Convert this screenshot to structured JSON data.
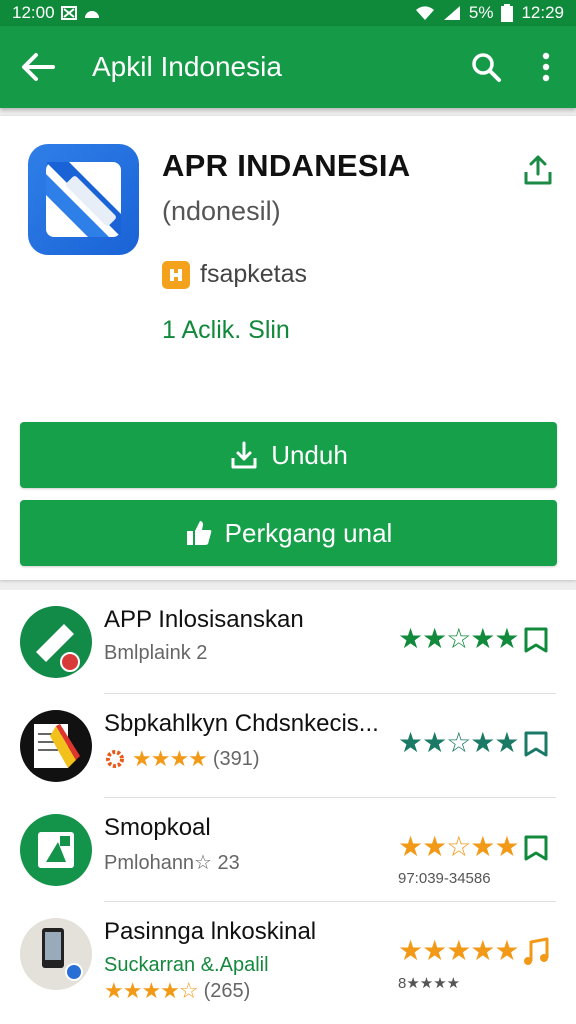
{
  "status_bar": {
    "time_left": "12:00",
    "battery": "5%",
    "time_right": "12:29"
  },
  "app_bar": {
    "title": "Apkil Indonesia"
  },
  "app": {
    "name": "APR INDANESIA",
    "subtitle": "(ndonesil)",
    "developer": "fsapketas",
    "install_info": "1 Aclik. Slin"
  },
  "buttons": {
    "primary_label": "Unduh",
    "secondary_label": "Perkgang unal"
  },
  "list": [
    {
      "title": "APP Inlosisanskan",
      "meta": "Bmlplaink  2",
      "stars": "★★☆★★",
      "star_color": "#128a3c"
    },
    {
      "title": "Sbpkahlkyn Chdsnkecis...",
      "meta_stars": "★★★★",
      "meta_count": "(391)",
      "stars": "★★☆★★",
      "star_color": "#1b7a66"
    },
    {
      "title": "Smopkoal",
      "meta": "Pmlohann☆ 23",
      "stars": "★★☆★★",
      "price": "97:039-34586",
      "star_color": "#f29a18"
    },
    {
      "title": "Pasinnga lnkoskinal",
      "meta": "Suckarran &.Apalil",
      "meta_stars": "★★★★☆",
      "meta_count": "(265)",
      "stars": "★★★★★",
      "price": "8★★★★",
      "star_color": "#f29a18"
    }
  ],
  "colors": {
    "primary": "#159a48",
    "status": "#0e8a3a",
    "accent_orange": "#f29a18"
  }
}
